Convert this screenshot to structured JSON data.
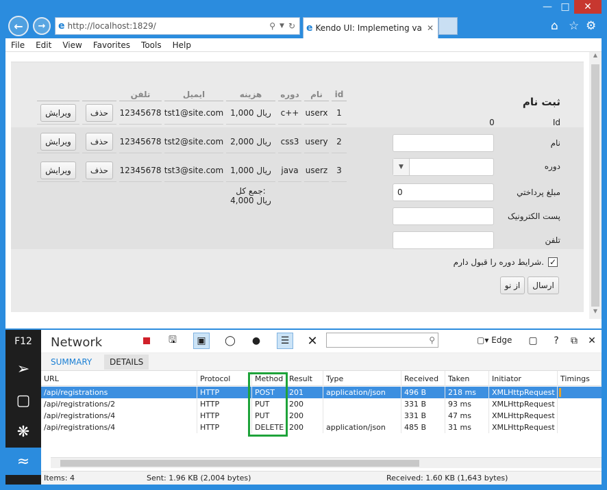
{
  "browser": {
    "url": "http://localhost:1829/",
    "tab_title": "Kendo UI: Implemeting vali...",
    "menu": [
      "File",
      "Edit",
      "View",
      "Favorites",
      "Tools",
      "Help"
    ]
  },
  "grid": {
    "headers": {
      "id": "id",
      "name": "نام",
      "course": "دوره",
      "fee": "هزینه",
      "email": "ایمیل",
      "phone": "تلفن"
    },
    "rows": [
      {
        "id": "1",
        "name": "userx",
        "course": "c++",
        "fee": "ریال 1,000",
        "email": "tst1@site.com",
        "phone": "12345678",
        "delete": "حذف",
        "edit": "ویرایش"
      },
      {
        "id": "2",
        "name": "usery",
        "course": "css3",
        "fee": "ریال 2,000",
        "email": "tst2@site.com",
        "phone": "12345678",
        "delete": "حذف",
        "edit": "ویرایش"
      },
      {
        "id": "3",
        "name": "userz",
        "course": "java",
        "fee": "ریال 1,000",
        "email": "tst3@site.com",
        "phone": "12345678",
        "delete": "حذف",
        "edit": "ویرایش"
      }
    ],
    "total_label": "جمع کل:",
    "total_value": "ریال 4,000"
  },
  "form": {
    "title": "ثبت نام",
    "id_label": "Id",
    "id_value": "0",
    "name_label": "نام",
    "course_label": "دوره",
    "amount_label": "مبلغ پرداختي",
    "amount_value": "0",
    "email_label": "پست الکترونيک",
    "phone_label": "تلفن",
    "terms_label": "شرايط دوره را قبول دارم.",
    "submit": "ارسال",
    "reset": "از نو"
  },
  "devtools": {
    "f12": "F12",
    "title": "Network",
    "edge": "Edge",
    "tabs": {
      "summary": "SUMMARY",
      "details": "DETAILS"
    },
    "columns": {
      "url": "URL",
      "protocol": "Protocol",
      "method": "Method",
      "result": "Result",
      "type": "Type",
      "received": "Received",
      "taken": "Taken",
      "initiator": "Initiator",
      "timings": "Timings"
    },
    "requests": [
      {
        "url": "/api/registrations",
        "protocol": "HTTP",
        "method": "POST",
        "result": "201",
        "type": "application/json",
        "received": "496 B",
        "taken": "218 ms",
        "initiator": "XMLHttpRequest"
      },
      {
        "url": "/api/registrations/2",
        "protocol": "HTTP",
        "method": "PUT",
        "result": "200",
        "type": "",
        "received": "331 B",
        "taken": "93 ms",
        "initiator": "XMLHttpRequest"
      },
      {
        "url": "/api/registrations/4",
        "protocol": "HTTP",
        "method": "PUT",
        "result": "200",
        "type": "",
        "received": "331 B",
        "taken": "47 ms",
        "initiator": "XMLHttpRequest"
      },
      {
        "url": "/api/registrations/4",
        "protocol": "HTTP",
        "method": "DELETE",
        "result": "200",
        "type": "application/json",
        "received": "485 B",
        "taken": "31 ms",
        "initiator": "XMLHttpRequest"
      }
    ],
    "status": {
      "items": "Items: 4",
      "sent": "Sent: 1.96 KB (2,004 bytes)",
      "received": "Received: 1.60 KB (1,643 bytes)"
    },
    "highlight_color": "#1ea33a"
  }
}
